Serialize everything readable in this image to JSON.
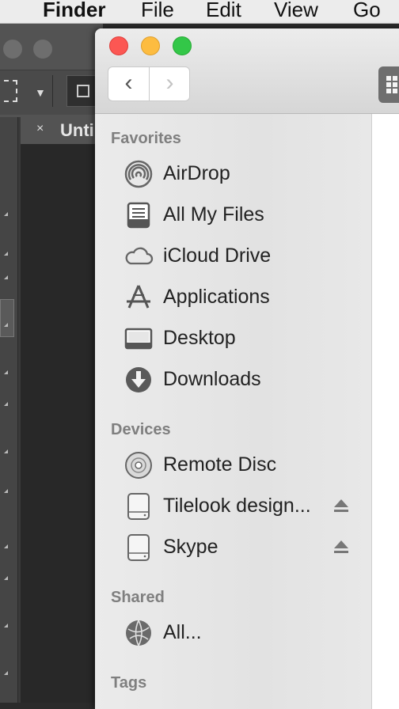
{
  "menubar": {
    "app": "Finder",
    "items": [
      "File",
      "Edit",
      "View",
      "Go"
    ]
  },
  "background_app": {
    "tab_title": "Unti",
    "tab_close": "×"
  },
  "finder": {
    "nav": {
      "back": "‹",
      "forward": "›"
    },
    "sections": [
      {
        "title": "Favorites",
        "items": [
          {
            "label": "AirDrop",
            "icon": "airdrop-icon"
          },
          {
            "label": "All My Files",
            "icon": "all-my-files-icon"
          },
          {
            "label": "iCloud Drive",
            "icon": "icloud-icon"
          },
          {
            "label": "Applications",
            "icon": "applications-icon"
          },
          {
            "label": "Desktop",
            "icon": "desktop-icon"
          },
          {
            "label": "Downloads",
            "icon": "downloads-icon"
          }
        ]
      },
      {
        "title": "Devices",
        "items": [
          {
            "label": "Remote Disc",
            "icon": "disc-icon"
          },
          {
            "label": "Tilelook design...",
            "icon": "drive-icon",
            "ejectable": true
          },
          {
            "label": "Skype",
            "icon": "drive-icon",
            "ejectable": true
          }
        ]
      },
      {
        "title": "Shared",
        "items": [
          {
            "label": "All...",
            "icon": "network-icon"
          }
        ]
      },
      {
        "title": "Tags",
        "items": []
      }
    ]
  }
}
